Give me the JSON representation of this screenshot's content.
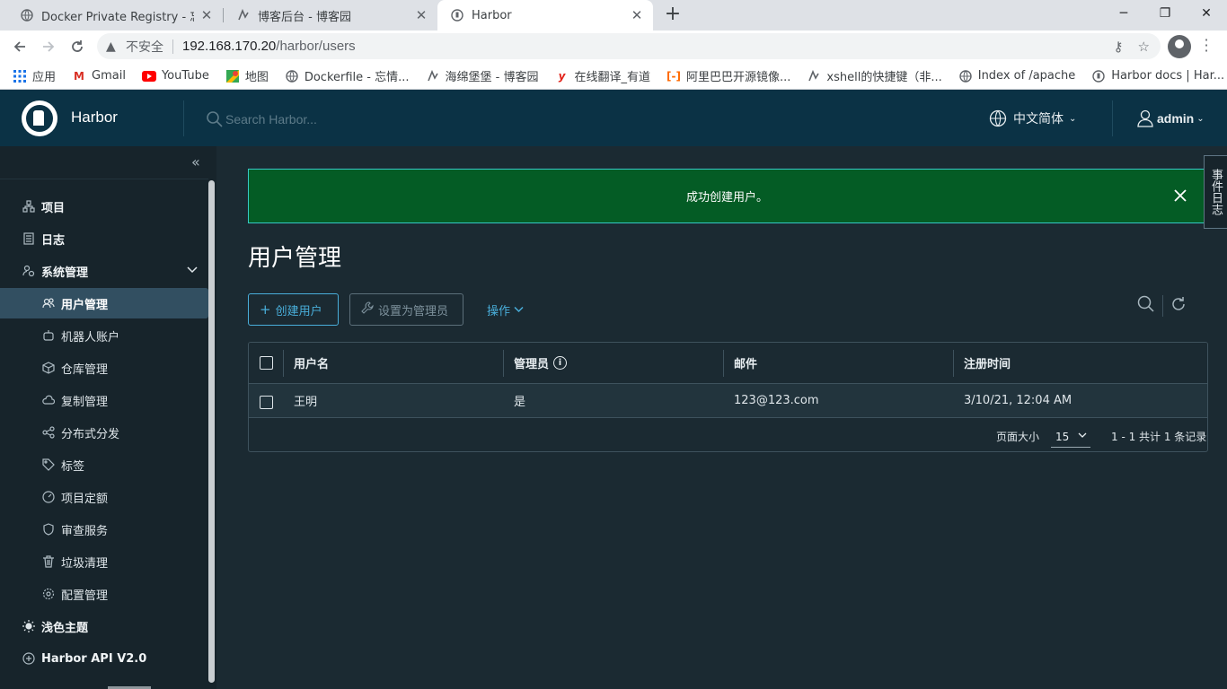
{
  "browser": {
    "tabs": [
      {
        "title": "Docker Private Registry - 忘情",
        "active": false
      },
      {
        "title": "博客后台 - 博客园",
        "active": false
      },
      {
        "title": "Harbor",
        "active": true
      }
    ],
    "new_tab": "+",
    "address": {
      "security_label": "不安全",
      "host": "192.168.170.20",
      "path": "/harbor/users"
    },
    "bookmarks": [
      {
        "label": "应用",
        "icon": "apps-grid-icon"
      },
      {
        "label": "Gmail",
        "icon": "gmail-icon"
      },
      {
        "label": "YouTube",
        "icon": "youtube-icon"
      },
      {
        "label": "地图",
        "icon": "maps-icon"
      },
      {
        "label": "Dockerfile - 忘情...",
        "icon": "globe-icon"
      },
      {
        "label": "海绵堡堡 - 博客园",
        "icon": "cnblogs-icon"
      },
      {
        "label": "在线翻译_有道",
        "icon": "youdao-icon"
      },
      {
        "label": "阿里巴巴开源镜像...",
        "icon": "aliyun-icon"
      },
      {
        "label": "xshell的快捷键（非...",
        "icon": "cnblogs-icon"
      },
      {
        "label": "Index of /apache",
        "icon": "globe-icon"
      },
      {
        "label": "Harbor docs | Har...",
        "icon": "harbor-icon"
      }
    ]
  },
  "header": {
    "brand": "Harbor",
    "search_placeholder": "Search Harbor...",
    "language": "中文简体",
    "user": "admin"
  },
  "sidebar": {
    "items": [
      {
        "label": "项目",
        "level": "top",
        "icon": "project-icon"
      },
      {
        "label": "日志",
        "level": "top",
        "icon": "log-icon"
      },
      {
        "label": "系统管理",
        "level": "top",
        "icon": "system-admin-icon",
        "expanded": true
      },
      {
        "label": "用户管理",
        "level": "sub",
        "icon": "users-icon",
        "active": true
      },
      {
        "label": "机器人账户",
        "level": "sub",
        "icon": "robot-icon"
      },
      {
        "label": "仓库管理",
        "level": "sub",
        "icon": "registry-icon"
      },
      {
        "label": "复制管理",
        "level": "sub",
        "icon": "replication-icon"
      },
      {
        "label": "分布式分发",
        "level": "sub",
        "icon": "distribution-icon"
      },
      {
        "label": "标签",
        "level": "sub",
        "icon": "tag-icon"
      },
      {
        "label": "项目定额",
        "level": "sub",
        "icon": "quota-icon"
      },
      {
        "label": "审查服务",
        "level": "sub",
        "icon": "shield-icon"
      },
      {
        "label": "垃圾清理",
        "level": "sub",
        "icon": "trash-icon"
      },
      {
        "label": "配置管理",
        "level": "sub",
        "icon": "gear-icon"
      },
      {
        "label": "浅色主题",
        "level": "top",
        "icon": "sun-icon"
      },
      {
        "label": "Harbor API V2.0",
        "level": "top",
        "icon": "api-icon"
      }
    ]
  },
  "main": {
    "alert": "成功创建用户。",
    "event_log": "事件日志",
    "title": "用户管理",
    "buttons": {
      "create_user": "创建用户",
      "set_admin": "设置为管理员",
      "actions": "操作"
    },
    "table": {
      "columns": [
        "用户名",
        "管理员",
        "邮件",
        "注册时间"
      ],
      "rows": [
        {
          "username": "王明",
          "admin": "是",
          "email": "123@123.com",
          "registered": "3/10/21, 12:04 AM"
        }
      ]
    },
    "pagination": {
      "page_size_label": "页面大小",
      "page_size": "15",
      "summary": "1 - 1 共计 1 条记录"
    }
  },
  "colors": {
    "header_bg": "#0b3245",
    "sidebar_bg": "#17242b",
    "main_bg": "#1b2a32",
    "alert_bg": "#045c25",
    "accent": "#49aeda"
  }
}
